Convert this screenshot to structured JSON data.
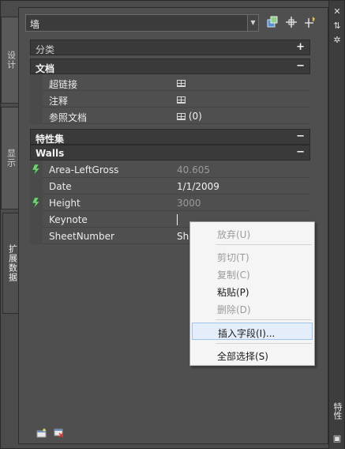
{
  "object_type": "墙",
  "left_tabs": [
    {
      "label": "设计"
    },
    {
      "label": "显示"
    },
    {
      "label": "扩展数据"
    }
  ],
  "right_strip_title": "特性",
  "sections": {
    "classification": {
      "label": "分类",
      "toggle": "+"
    },
    "document": {
      "label": "文档",
      "toggle": "−"
    },
    "property_sets": {
      "label": "特性集",
      "toggle": "−"
    },
    "walls": {
      "label": "Walls",
      "toggle": "−"
    }
  },
  "document_rows": [
    {
      "name": "超链接",
      "value": ""
    },
    {
      "name": "注释",
      "value": ""
    },
    {
      "name": "参照文档",
      "value": "(0)"
    }
  ],
  "walls_rows": [
    {
      "name": "Area-LeftGross",
      "value": "40.605",
      "lightning": true,
      "dim": true
    },
    {
      "name": "Date",
      "value": "1/1/2009",
      "lightning": false,
      "dim": false
    },
    {
      "name": "Height",
      "value": "3000",
      "lightning": true,
      "dim": true
    },
    {
      "name": "Keynote",
      "value": "",
      "lightning": false,
      "dim": false
    },
    {
      "name": "SheetNumber",
      "value": "She",
      "lightning": false,
      "dim": false
    }
  ],
  "context_menu": {
    "undo": "放弃(U)",
    "cut": "剪切(T)",
    "copy": "复制(C)",
    "paste": "粘贴(P)",
    "delete": "删除(D)",
    "insert_field": "插入字段(I)...",
    "select_all": "全部选择(S)"
  },
  "colors": {
    "panel_bg": "#4f4f4f",
    "section_bg": "#3a3a3a",
    "lightning": "#6fd36f",
    "menu_bg": "#f5f5f5",
    "menu_highlight": "#e3eefa"
  }
}
